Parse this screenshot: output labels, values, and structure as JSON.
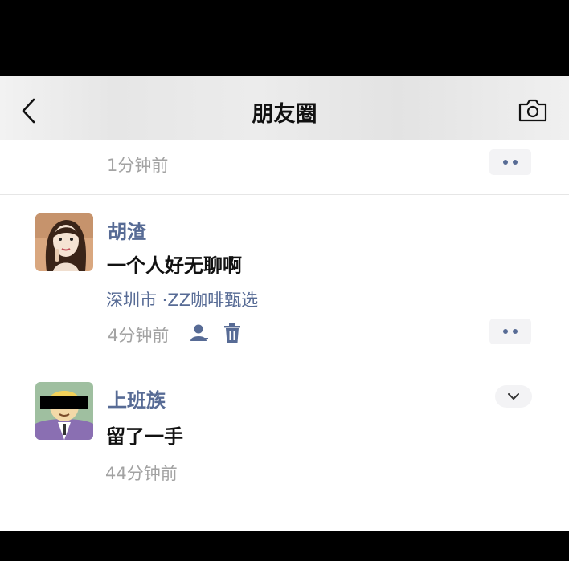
{
  "nav": {
    "title": "朋友圈"
  },
  "posts": [
    {
      "time": "1分钟前"
    },
    {
      "name": "胡渣",
      "text": "一个人好无聊啊",
      "location": "深圳市 ·ZZ咖啡甄选",
      "time": "4分钟前"
    },
    {
      "name": "上班族",
      "text": "留了一手",
      "time": "44分钟前"
    }
  ],
  "colors": {
    "link": "#576b95",
    "time": "#a3a3a3",
    "text": "#111111"
  }
}
